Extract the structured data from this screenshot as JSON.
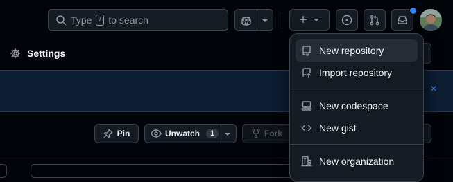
{
  "header": {
    "search_prefix": "Type",
    "search_key": "/",
    "search_suffix": "to search",
    "create_plus": "+",
    "notification_color": "#2f81f7"
  },
  "settings_tab": {
    "label": "Settings"
  },
  "banner": {
    "close": "×"
  },
  "actions": {
    "pin_label": "Pin",
    "unwatch_label": "Unwatch",
    "watch_count": "1",
    "fork_label": "Fork"
  },
  "create_menu": {
    "items": [
      {
        "label": "New repository",
        "icon": "repo-icon"
      },
      {
        "label": "Import repository",
        "icon": "repo-push-icon"
      },
      {
        "label": "New codespace",
        "icon": "codespaces-icon"
      },
      {
        "label": "New gist",
        "icon": "code-icon"
      },
      {
        "label": "New organization",
        "icon": "organization-icon"
      }
    ]
  }
}
